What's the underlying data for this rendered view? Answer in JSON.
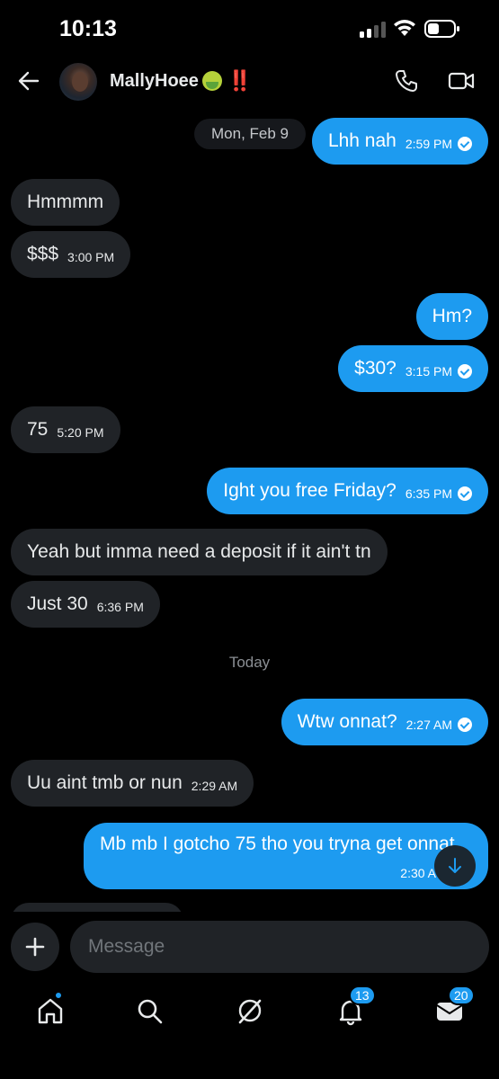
{
  "status_bar": {
    "time": "10:13"
  },
  "header": {
    "contact_name": "MallyHoee",
    "contact_emoji": "sick-face-emoji",
    "contact_marks": "‼️"
  },
  "date_markers": {
    "first": "Mon, Feb 9",
    "second": "Today"
  },
  "messages": [
    {
      "dir": "out",
      "text": "Lhh nah",
      "time": "2:59 PM",
      "seen": true
    },
    {
      "dir": "in",
      "text": "Hmmmm",
      "time": ""
    },
    {
      "dir": "in",
      "text": "$$$",
      "time": "3:00 PM"
    },
    {
      "dir": "out",
      "text": "Hm?",
      "time": "",
      "seen": false
    },
    {
      "dir": "out",
      "text": "$30?",
      "time": "3:15 PM",
      "seen": true
    },
    {
      "dir": "in",
      "text": "75",
      "time": "5:20 PM"
    },
    {
      "dir": "out",
      "text": "Ight you free Friday?",
      "time": "6:35 PM",
      "seen": true
    },
    {
      "dir": "in",
      "text": "Yeah but imma need a deposit if it ain't tn",
      "time": ""
    },
    {
      "dir": "in",
      "text": "Just 30",
      "time": "6:36 PM"
    },
    {
      "dir": "out",
      "text": "Wtw onnat?",
      "time": "2:27 AM",
      "seen": true
    },
    {
      "dir": "in",
      "text": "Uu aint tmb or nun",
      "time": "2:29 AM"
    },
    {
      "dir": "out",
      "text": "Mb mb I gotcho 75 tho you tryna get onnat",
      "time": "2:30 A",
      "seen": false
    }
  ],
  "composer": {
    "placeholder": "Message"
  },
  "nav": {
    "notifications_badge": "13",
    "messages_badge": "20"
  },
  "colors": {
    "accent": "#1d9bf0",
    "incoming_bubble": "#202327",
    "background": "#000000"
  }
}
